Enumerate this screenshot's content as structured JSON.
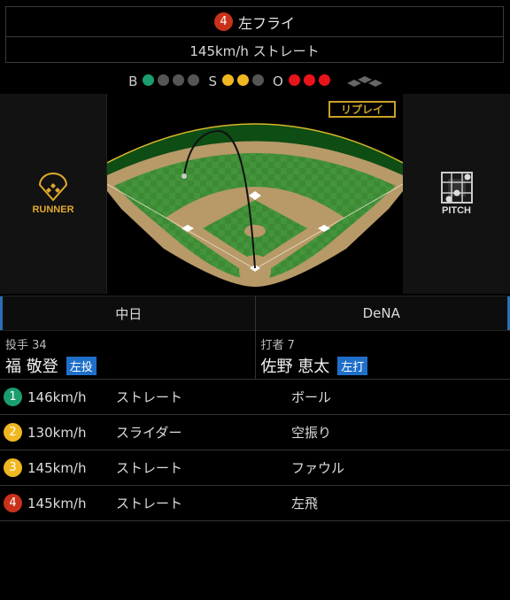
{
  "summary": {
    "pitch_number": "4",
    "pitch_color": "#c8321a",
    "result": "左フライ",
    "pitch_info": "145km/h ストレート"
  },
  "count": {
    "ball_label": "B",
    "strike_label": "S",
    "out_label": "O",
    "balls": 1,
    "balls_max": 4,
    "strikes": 2,
    "strikes_max": 3,
    "outs": 3,
    "outs_max": 3,
    "ball_color": "#1a9e6e",
    "strike_color": "#f0b820",
    "out_color": "#e8141c",
    "off_color": "#555555",
    "runners_on": []
  },
  "field": {
    "replay_label": "リプレイ",
    "runner_label": "RUNNER",
    "pitch_label": "PITCH",
    "accent": "#c9a227"
  },
  "teams": {
    "home": "中日",
    "away": "DeNA"
  },
  "pitcher": {
    "role": "投手 34",
    "name": "福 敬登",
    "hand": "左投"
  },
  "batter": {
    "role": "打者 7",
    "name": "佐野 恵太",
    "hand": "左打"
  },
  "pitches": [
    {
      "num": "1",
      "color": "#1a9e6e",
      "speed": "146km/h",
      "type": "ストレート",
      "result": "ボール"
    },
    {
      "num": "2",
      "color": "#f0b820",
      "speed": "130km/h",
      "type": "スライダー",
      "result": "空振り"
    },
    {
      "num": "3",
      "color": "#f0b820",
      "speed": "145km/h",
      "type": "ストレート",
      "result": "ファウル"
    },
    {
      "num": "4",
      "color": "#c8321a",
      "speed": "145km/h",
      "type": "ストレート",
      "result": "左飛"
    }
  ]
}
